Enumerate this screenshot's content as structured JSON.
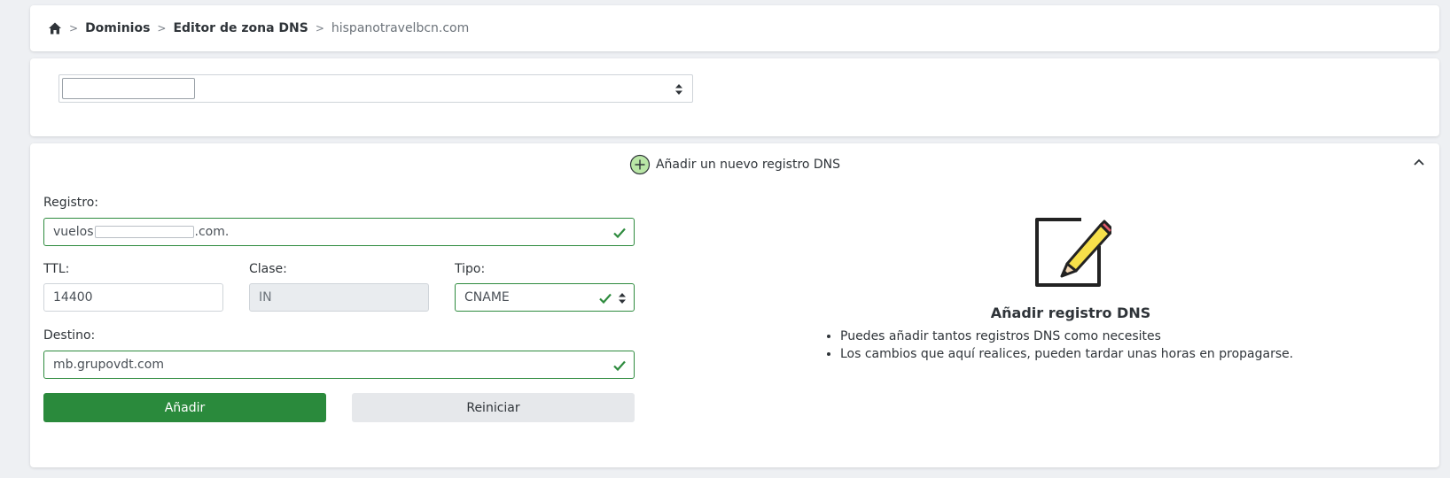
{
  "breadcrumb": {
    "items": [
      "Dominios",
      "Editor de zona DNS"
    ],
    "current": "hispanotravelbcn.com"
  },
  "form": {
    "header_title": "Añadir un nuevo registro DNS",
    "registro_label": "Registro:",
    "registro_prefix": "vuelos",
    "registro_suffix": ".com.",
    "ttl_label": "TTL:",
    "ttl_value": "14400",
    "clase_label": "Clase:",
    "clase_value": "IN",
    "tipo_label": "Tipo:",
    "tipo_value": "CNAME",
    "destino_label": "Destino:",
    "destino_value": "mb.grupovdt.com",
    "add_button": "Añadir",
    "reset_button": "Reiniciar"
  },
  "help": {
    "title": "Añadir registro DNS",
    "bullets": [
      "Puedes añadir tantos registros DNS como necesites",
      "Los cambios que aquí realices, pueden tardar unas horas en propagarse."
    ]
  },
  "colors": {
    "accent_green": "#2a8a3c",
    "valid_border": "#2e8b3e"
  }
}
